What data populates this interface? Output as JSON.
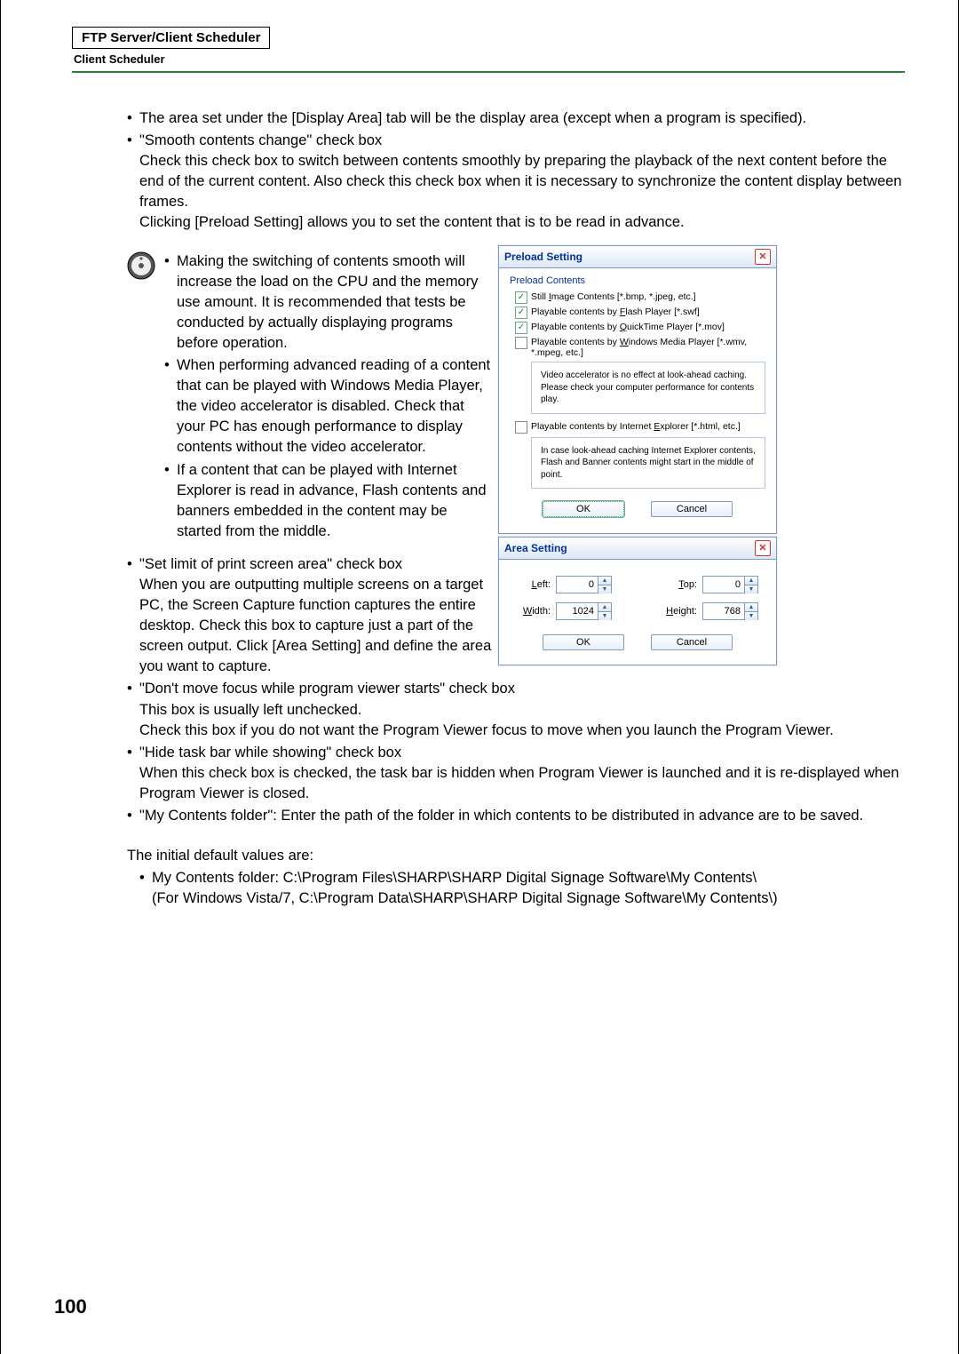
{
  "header": {
    "title": "FTP Server/Client Scheduler",
    "subtitle": "Client Scheduler"
  },
  "page_number": "100",
  "bullets_top": {
    "b1": "The area set under the [Display Area] tab will be the display area (except when a program is specified).",
    "b2_title": "\"Smooth contents change\" check box",
    "b2_p1": "Check this check box to switch between contents smoothly by preparing the playback of the next content before the end of the current content. Also check this check box when it is necessary to synchronize the content display between frames.",
    "b2_p2": "Clicking [Preload Setting] allows you to set the content that is to be read in advance."
  },
  "note_bullets": {
    "n1": "Making the switching of contents smooth will increase the load on the CPU and the memory use amount. It is recommended that tests be conducted by actually displaying programs before operation.",
    "n2": "When performing advanced reading of a content that can be played with Windows Media Player, the video accelerator is disabled. Check that your PC has enough performance to display contents without the video accelerator.",
    "n3": "If a content that can be played with Internet Explorer is read in advance, Flash contents and banners embedded in the content may be started from the middle."
  },
  "bullets_mid": {
    "b3_title": "\"Set limit of print screen area\" check box",
    "b3_body": "When you are outputting multiple screens on a target PC, the Screen Capture function captures the entire desktop. Check this box to capture just a part of the screen output. Click [Area Setting] and define the area you want to capture.",
    "b4_title": "\"Don't move focus while program viewer starts\" check box",
    "b4_l1": "This box is usually left unchecked.",
    "b4_l2": "Check this box if you do not want the Program Viewer focus to move when you launch the Program Viewer.",
    "b5_title": "\"Hide task bar while showing\" check box",
    "b5_body": "When this check box is checked, the task bar is hidden when Program Viewer is launched and it is re-displayed when Program Viewer is closed.",
    "b6": "\"My Contents folder\": Enter the path of the folder in which contents to be distributed in advance are to be saved."
  },
  "defaults": {
    "intro": "The initial default values are:",
    "d1": "My Contents folder: C:\\Program Files\\SHARP\\SHARP Digital Signage Software\\My Contents\\",
    "d2": "(For Windows Vista/7, C:\\Program Data\\SHARP\\SHARP Digital Signage Software\\My Contents\\)"
  },
  "preload_dialog": {
    "title": "Preload Setting",
    "group": "Preload Contents",
    "c1": "Still Image Contents [*.bmp, *.jpeg, etc.]",
    "c2": "Playable contents by Flash Player [*.swf]",
    "c3": "Playable contents by QuickTime Player [*.mov]",
    "c4": "Playable contents by Windows Media Player [*.wmv, *.mpeg, etc.]",
    "info1": "Video accelerator is no effect at look-ahead caching. Please check your computer performance for contents play.",
    "c5": "Playable contents by Internet Explorer [*.html, etc.]",
    "info2": "In case look-ahead caching Internet Explorer contents, Flash and Banner contents might start in the middle of point.",
    "ok": "OK",
    "cancel": "Cancel"
  },
  "area_dialog": {
    "title": "Area Setting",
    "left_lbl": "Left:",
    "left_val": "0",
    "top_lbl": "Top:",
    "top_val": "0",
    "width_lbl": "Width:",
    "width_val": "1024",
    "height_lbl": "Height:",
    "height_val": "768",
    "ok": "OK",
    "cancel": "Cancel"
  }
}
